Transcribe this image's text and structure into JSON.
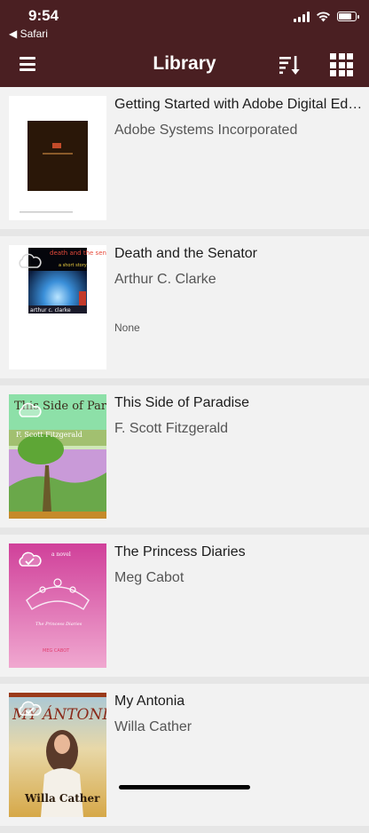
{
  "status": {
    "time": "9:54",
    "back_label": "◀ Safari"
  },
  "nav": {
    "title": "Library",
    "menu_icon": "hamburger-icon",
    "sort_icon": "sort-icon",
    "grid_icon": "grid-view-icon"
  },
  "books": [
    {
      "title": "Getting Started with Adobe Digital Editions",
      "author": "Adobe Systems Incorporated",
      "meta": "",
      "cover": "adobe"
    },
    {
      "title": "Death and the Senator",
      "author": "Arthur C. Clarke",
      "meta": "None",
      "cover": "death",
      "cover_text": {
        "top": "death and the senator",
        "sub": "a short story",
        "bottom": "arthur c. clarke"
      }
    },
    {
      "title": "This Side of Paradise",
      "author": "F. Scott Fitzgerald",
      "meta": "",
      "cover": "paradise",
      "cover_text": {
        "top": "This Side of Paradise",
        "sub": "F. Scott Fitzgerald"
      }
    },
    {
      "title": "The Princess Diaries",
      "author": "Meg Cabot",
      "meta": "",
      "cover": "princess",
      "cover_text": {
        "top": "a novel",
        "sub": "The Princess Diaries",
        "bottom": "MEG CABOT"
      }
    },
    {
      "title": "My Antonia",
      "author": "Willa Cather",
      "meta": "",
      "cover": "antonia",
      "cover_text": {
        "top": "MY ÁNTONIA",
        "bottom": "Willa Cather"
      }
    }
  ],
  "colors": {
    "bar": "#4a1f22",
    "background": "#f2f2f2",
    "separator": "#e6e6e6"
  }
}
